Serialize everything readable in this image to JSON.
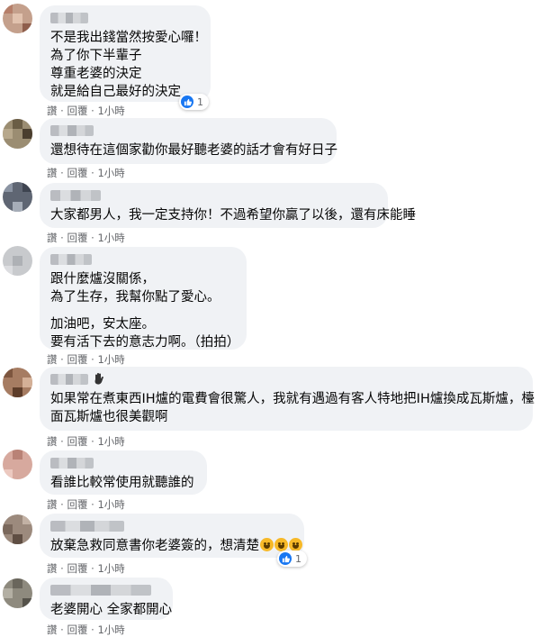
{
  "comments": [
    {
      "lines": [
        "不是我出錢當然按愛心囉！",
        "為了你下半輩子",
        "尊重老婆的決定",
        "就是給自己最好的決定"
      ],
      "actions": {
        "a": "讚",
        "b": "回覆",
        "time": "1小時"
      },
      "reaction_count": "1"
    },
    {
      "lines": [
        "還想待在這個家勸你最好聽老婆的話才會有好日子"
      ],
      "actions": {
        "a": "讚",
        "b": "回覆",
        "time": "1小時"
      }
    },
    {
      "lines": [
        "大家都男人，我一定支持你！不過希望你贏了以後，還有床能睡"
      ],
      "actions": {
        "a": "讚",
        "b": "回覆",
        "time": "1小時"
      }
    },
    {
      "lines": [
        "跟什麼爐沒關係，",
        "為了生存，我幫你點了愛心。",
        "加油吧，安太座。",
        "要有活下去的意志力啊。（拍拍）"
      ],
      "actions": {
        "a": "讚",
        "b": "回覆",
        "time": "1小時"
      }
    },
    {
      "lines": [
        "如果常在煮東西IH爐的電費會很驚人，我就有遇過有客人特地把IH爐換成瓦斯爐，檯",
        "面瓦斯爐也很美觀啊"
      ],
      "actions": {
        "a": "讚",
        "b": "回覆",
        "time": "1小時"
      }
    },
    {
      "lines": [
        "看誰比較常使用就聽誰的"
      ],
      "actions": {
        "a": "讚",
        "b": "回覆",
        "time": "1小時"
      }
    },
    {
      "lines": [
        "放棄急救同意書你老婆簽的，想清楚"
      ],
      "actions": {
        "a": "讚",
        "b": "回覆",
        "time": "1小時"
      },
      "reaction_count": "1"
    },
    {
      "lines": [
        "老婆開心 全家都開心"
      ],
      "actions": {
        "a": "讚",
        "b": "回覆",
        "time": "1小時"
      }
    }
  ],
  "icons": {
    "like": "like-reaction-icon",
    "emoji": "laughing-emoji-icon",
    "wave": "hand-wave-icon"
  },
  "colors": {
    "bubble": "#f0f2f5",
    "like": "#1877f2",
    "meta": "#65676b"
  }
}
